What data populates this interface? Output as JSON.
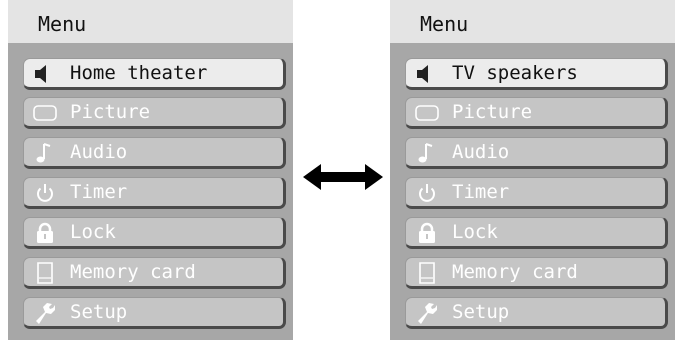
{
  "left_menu": {
    "title": "Menu",
    "items": [
      {
        "label": "Home theater",
        "icon": "speaker-icon"
      },
      {
        "label": "Picture",
        "icon": "screen-icon"
      },
      {
        "label": "Audio",
        "icon": "music-note-icon"
      },
      {
        "label": "Timer",
        "icon": "power-icon"
      },
      {
        "label": "Lock",
        "icon": "padlock-icon"
      },
      {
        "label": "Memory card",
        "icon": "memory-card-icon"
      },
      {
        "label": "Setup",
        "icon": "wrench-icon"
      }
    ]
  },
  "right_menu": {
    "title": "Menu",
    "items": [
      {
        "label": "TV speakers",
        "icon": "speaker-icon"
      },
      {
        "label": "Picture",
        "icon": "screen-icon"
      },
      {
        "label": "Audio",
        "icon": "music-note-icon"
      },
      {
        "label": "Timer",
        "icon": "power-icon"
      },
      {
        "label": "Lock",
        "icon": "padlock-icon"
      },
      {
        "label": "Memory card",
        "icon": "memory-card-icon"
      },
      {
        "label": "Setup",
        "icon": "wrench-icon"
      }
    ]
  },
  "colors": {
    "panel_background": "#a7a7a7",
    "header_background": "#e4e4e4",
    "item_background": "#c5c5c5",
    "selected_item_background": "#ececec",
    "item_text": "#ffffff",
    "selected_item_text": "#111111"
  },
  "swap_indicator": {
    "icon": "double-arrow-icon"
  }
}
